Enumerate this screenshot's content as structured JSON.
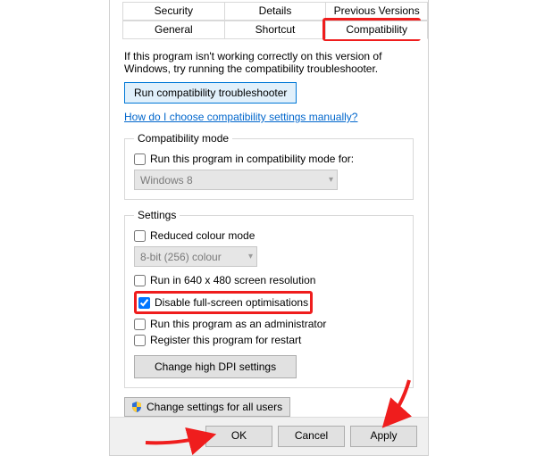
{
  "tabs": {
    "row1": [
      "Security",
      "Details",
      "Previous Versions"
    ],
    "row2": [
      "General",
      "Shortcut",
      "Compatibility"
    ],
    "active": "Compatibility"
  },
  "intro": "If this program isn't working correctly on this version of Windows, try running the compatibility troubleshooter.",
  "troubleshooter_btn": "Run compatibility troubleshooter",
  "help_link": "How do I choose compatibility settings manually?",
  "compat_mode": {
    "legend": "Compatibility mode",
    "checkbox_label": "Run this program in compatibility mode for:",
    "combo_value": "Windows 8"
  },
  "settings": {
    "legend": "Settings",
    "reduced_colour": "Reduced colour mode",
    "colour_combo": "8-bit (256) colour",
    "run_640": "Run in 640 x 480 screen resolution",
    "disable_fullscreen": "Disable full-screen optimisations",
    "run_admin": "Run this program as an administrator",
    "register_restart": "Register this program for restart",
    "dpi_btn": "Change high DPI settings"
  },
  "all_users_btn": "Change settings for all users",
  "footer": {
    "ok": "OK",
    "cancel": "Cancel",
    "apply": "Apply"
  }
}
